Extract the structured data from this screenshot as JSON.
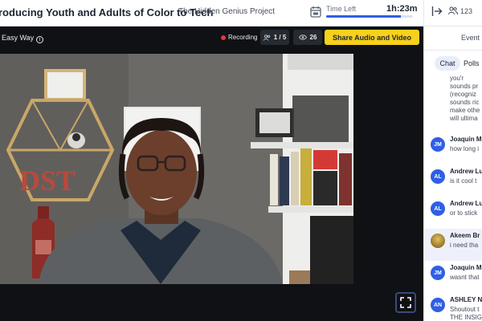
{
  "header": {
    "event_title": "roducing Youth and Adults of Color to Tech",
    "org_name": "The Hidden Genius Project",
    "time_left_label": "Time Left",
    "time_left_value": "1h:23m",
    "time_progress": 0.86,
    "attendee_count": "123"
  },
  "stage": {
    "name": "Easy Way",
    "recording_label": "Recording",
    "on_stage": "1 / 5",
    "viewers": "26",
    "share_button": "Share Audio and Video"
  },
  "panel": {
    "tab_event": "Event",
    "subtab_chat": "Chat",
    "subtab_polls": "Polls",
    "continued_lines": [
      "you'r",
      "sounds pr",
      "(recogniz",
      "sounds ric",
      "make othe",
      "will ultima"
    ],
    "messages": [
      {
        "initials": "JM",
        "sender": "Joaquin M",
        "text": "how long i",
        "text2": "",
        "photo": false
      },
      {
        "initials": "AL",
        "sender": "Andrew Lu",
        "text": "is it cool t",
        "text2": "",
        "photo": false
      },
      {
        "initials": "AL",
        "sender": "Andrew Lu",
        "text": "or to stick",
        "text2": "",
        "photo": false
      },
      {
        "initials": "",
        "sender": "Akeem Br",
        "text": "i need tha",
        "text2": "",
        "photo": true
      },
      {
        "initials": "JM",
        "sender": "Joaquin M",
        "text": "wasnt that",
        "text2": "",
        "photo": false
      },
      {
        "initials": "AN",
        "sender": "ASHLEY N",
        "text": "Shoutout t",
        "text2": "THE INSIG",
        "photo": false
      }
    ]
  },
  "shelf_sign": "DST",
  "colors": {
    "accent_blue": "#2f5fe4",
    "share_yellow": "#f7d11b",
    "stage_bg": "#0f1114",
    "recording_red": "#e53935"
  },
  "icons": [
    "calendar-icon",
    "exit-icon",
    "people-icon",
    "info-icon",
    "people-stage-icon",
    "eye-icon",
    "fullscreen-icon"
  ]
}
